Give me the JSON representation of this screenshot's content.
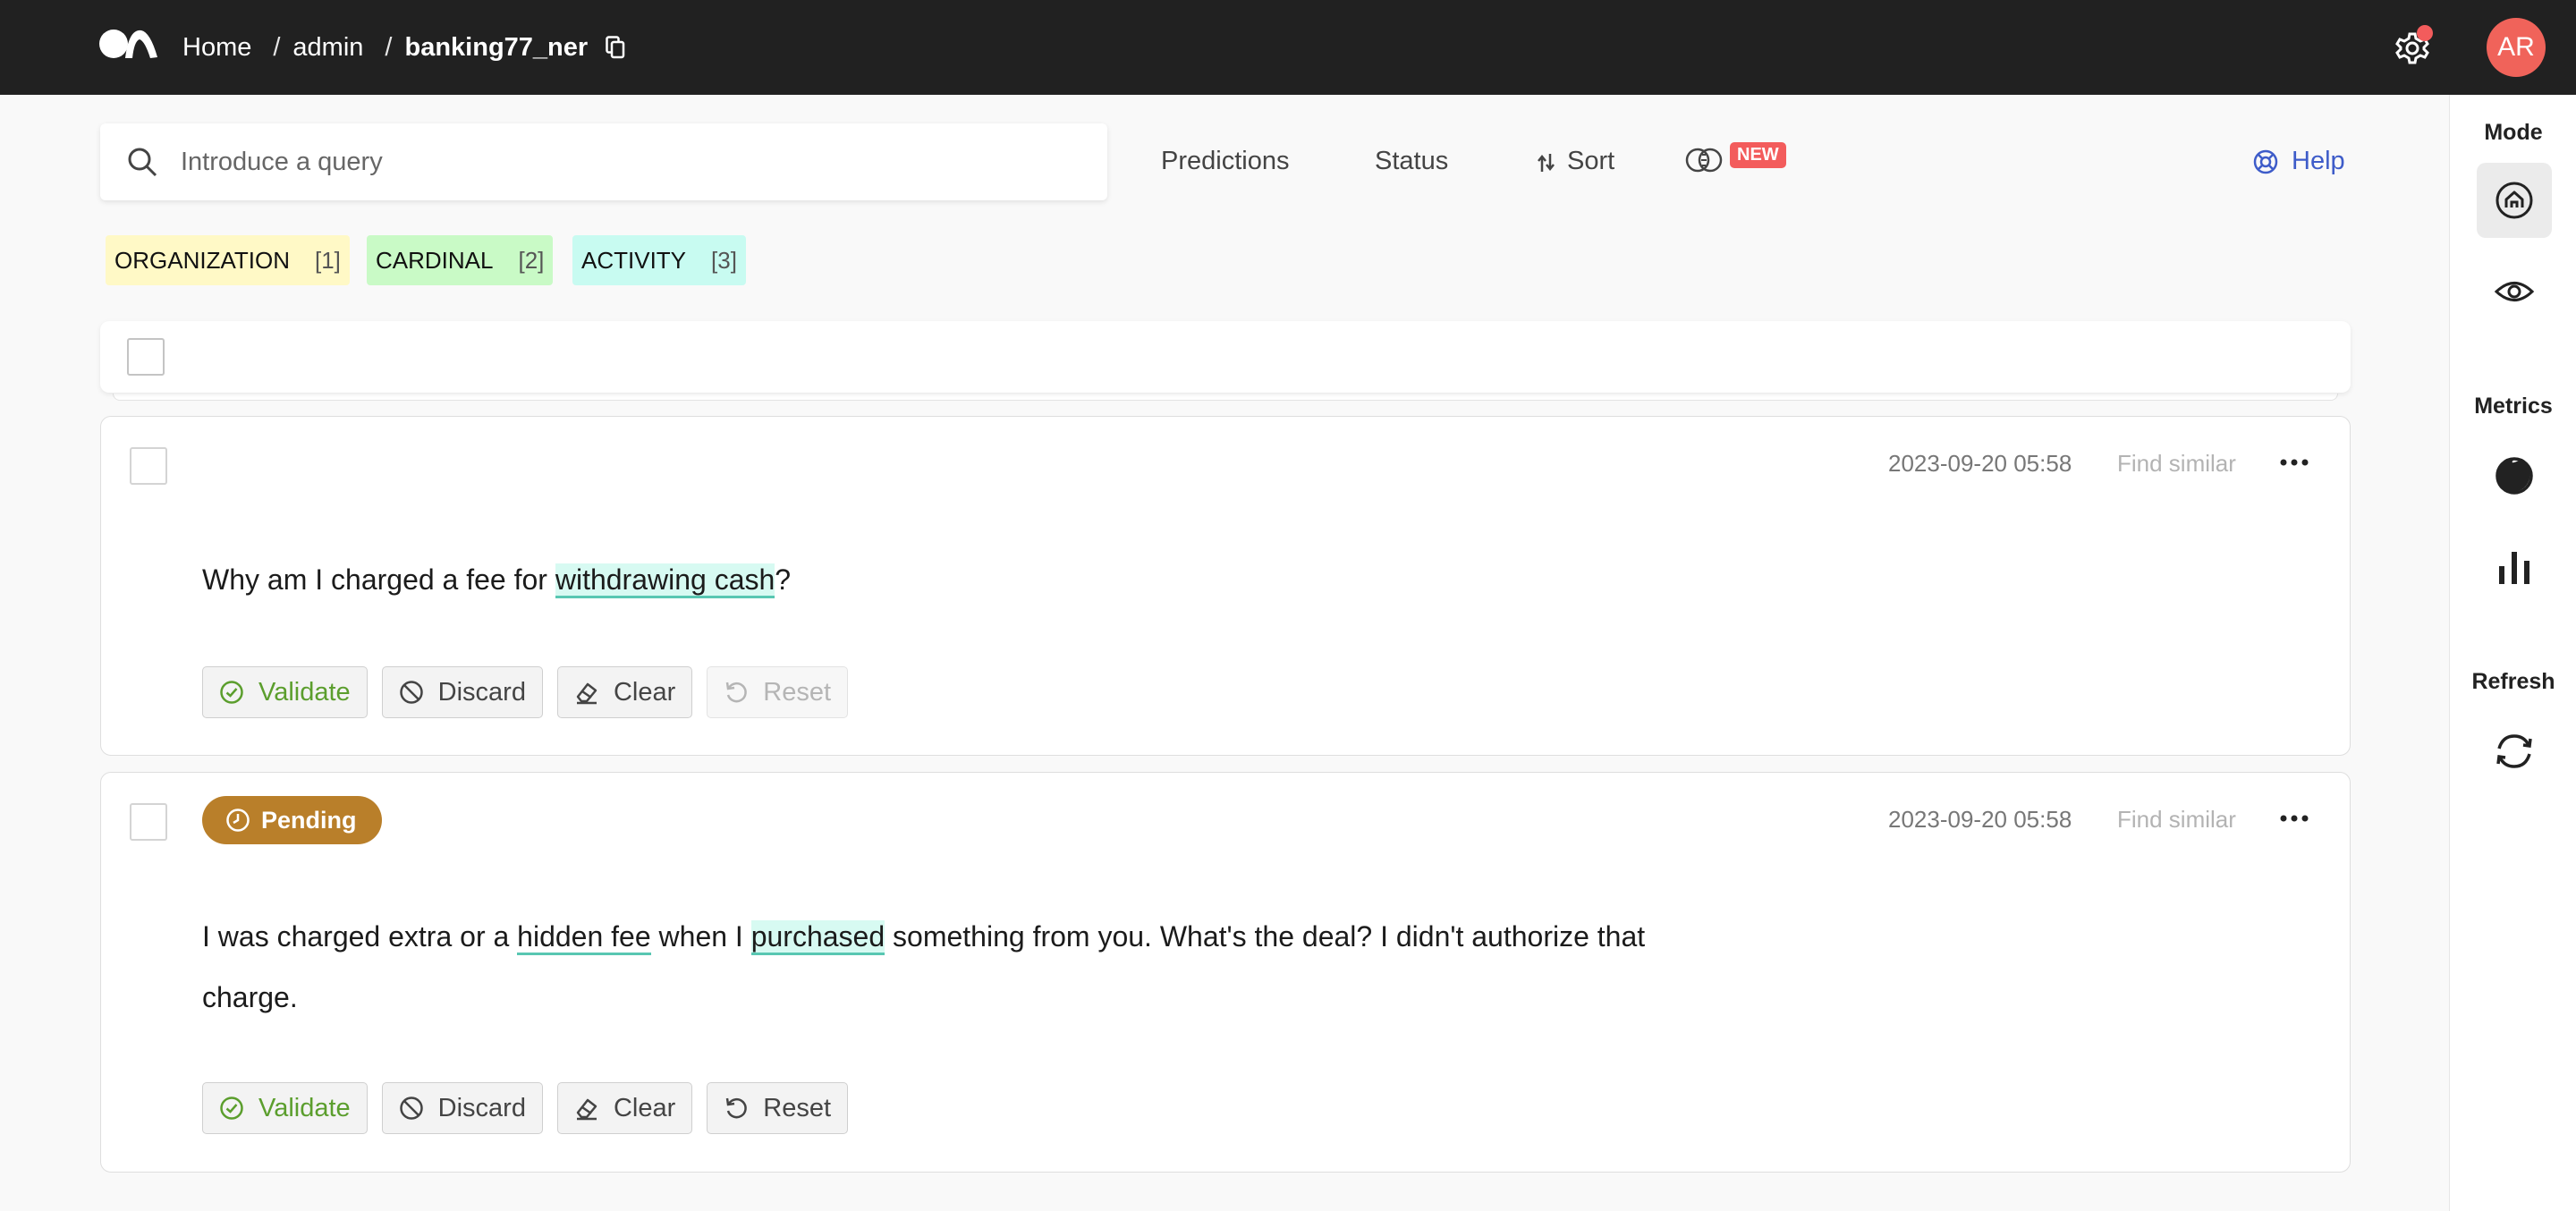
{
  "header": {
    "breadcrumb": [
      "Home",
      "admin"
    ],
    "dataset": "banking77_ner",
    "avatar_initials": "AR"
  },
  "search": {
    "placeholder": "Introduce a query",
    "value": ""
  },
  "filters": {
    "predictions": "Predictions",
    "status": "Status",
    "sort": "Sort",
    "new_badge": "NEW",
    "help": "Help"
  },
  "labels": [
    {
      "name": "ORGANIZATION",
      "count": "[1]",
      "color": "#fff9c6"
    },
    {
      "name": "CARDINAL",
      "count": "[2]",
      "color": "#c9fac6"
    },
    {
      "name": "ACTIVITY",
      "count": "[3]",
      "color": "#c8fbf1"
    }
  ],
  "sidebar": {
    "mode_title": "Mode",
    "metrics_title": "Metrics",
    "refresh_title": "Refresh"
  },
  "records": [
    {
      "date": "2023-09-20 05:58",
      "find_similar": "Find similar",
      "text_parts": [
        "Why am I charged a fee for ",
        "withdrawing cash",
        "?"
      ],
      "actions": {
        "validate": "Validate",
        "discard": "Discard",
        "clear": "Clear",
        "reset": "Reset"
      }
    },
    {
      "status": "Pending",
      "date": "2023-09-20 05:58",
      "find_similar": "Find similar",
      "text_parts": [
        "I was charged extra or a ",
        "hidden fee",
        " when I ",
        "purchased",
        " something from you. What's the deal? I didn't authorize that charge."
      ],
      "actions": {
        "validate": "Validate",
        "discard": "Discard",
        "clear": "Clear",
        "reset": "Reset"
      }
    }
  ]
}
